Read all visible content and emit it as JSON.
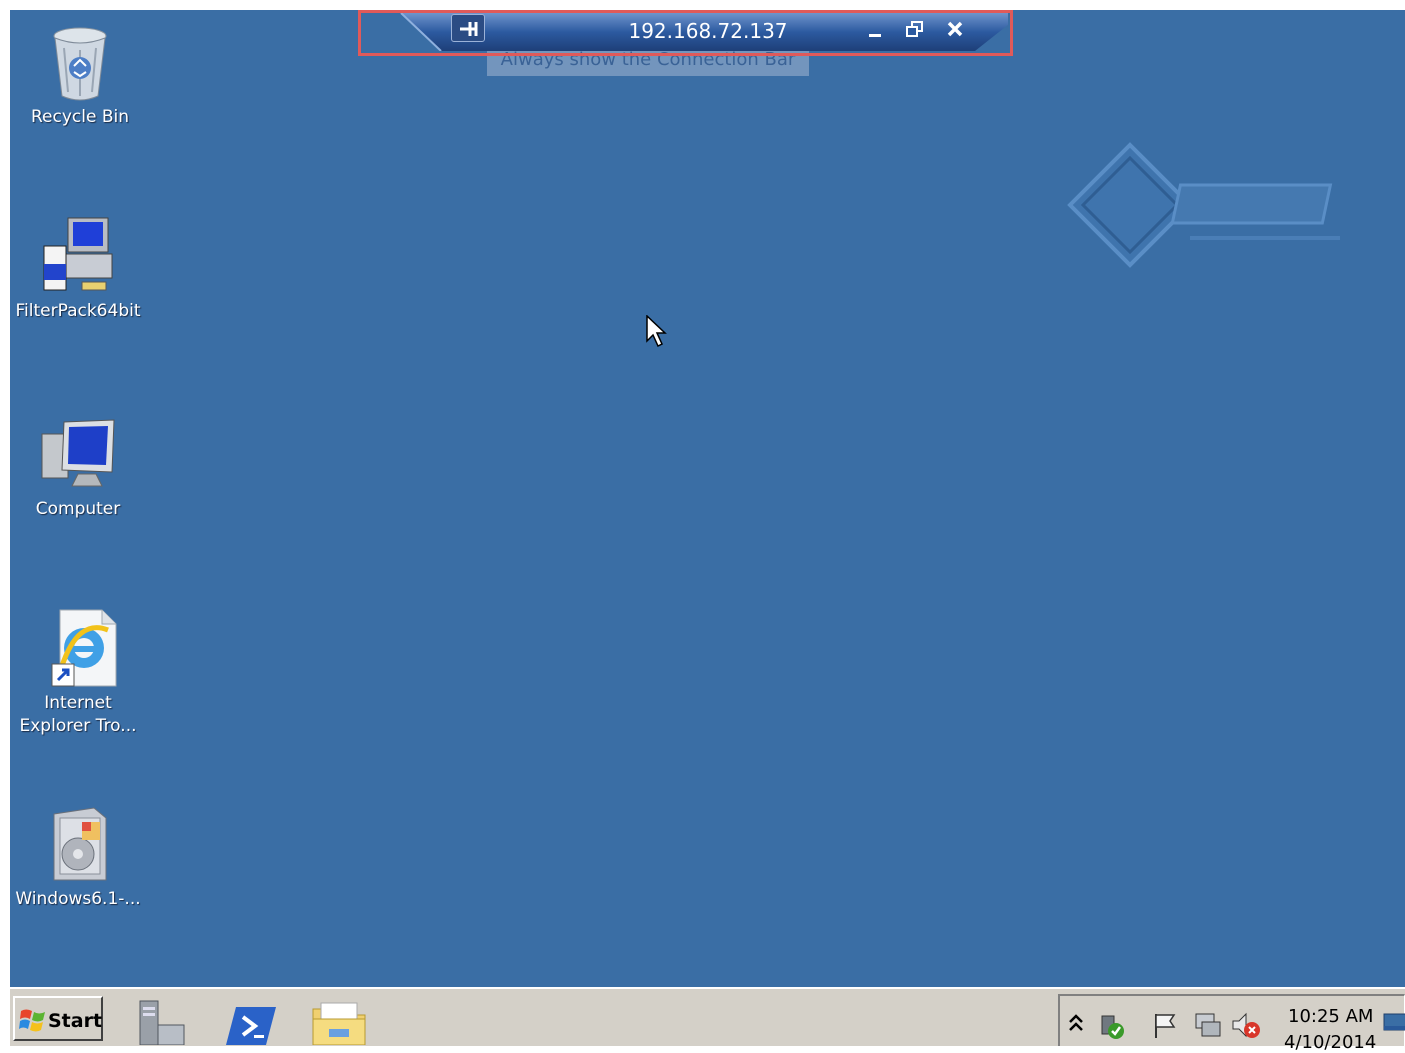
{
  "connection_bar": {
    "title": "192.168.72.137",
    "tooltip": "Always show the Connection Bar"
  },
  "desktop_icons": [
    {
      "label": "Recycle Bin",
      "icon": "recycle-bin-icon"
    },
    {
      "label": "FilterPack64bit",
      "icon": "installer-icon"
    },
    {
      "label": "Computer",
      "icon": "computer-icon"
    },
    {
      "label": "Internet Explorer Tro...",
      "icon": "internet-explorer-icon"
    },
    {
      "label": "Windows6.1-...",
      "icon": "windows-update-package-icon"
    }
  ],
  "taskbar": {
    "start_label": "Start",
    "quick_launch": [
      "server-manager-icon",
      "powershell-icon",
      "explorer-folder-icon"
    ],
    "tray": {
      "icons": [
        "show-hidden-icons-chevron",
        "network-check-icon",
        "action-center-flag-icon",
        "network-icon",
        "volume-muted-icon"
      ],
      "time": "10:25 AM",
      "date": "4/10/2014"
    }
  },
  "colors": {
    "desktop": "#3a6ea5",
    "connection_outline": "#e05a5a",
    "taskbar": "#d4d0c8"
  }
}
